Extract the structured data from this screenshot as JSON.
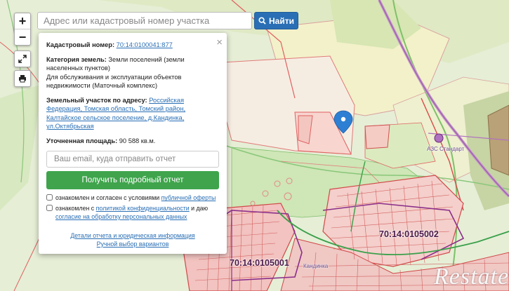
{
  "search": {
    "placeholder": "Адрес или кадастровый номер участка",
    "button_label": "Найти"
  },
  "map_controls": {
    "zoom_in": "+",
    "zoom_out": "−"
  },
  "popup": {
    "close": "×",
    "cadastral_label": "Кадастровый номер:",
    "cadastral_number": "70:14:0100041:877",
    "category_label": "Категория земель:",
    "category_value": "Земли поселений (земли населенных пунктов)",
    "usage": "Для обслуживания и эксплуатации объектов недвижимости (Маточный комплекс)",
    "address_label": "Земельный участок по адресу:",
    "address_value": "Российская Федерация, Томская область, Томский район, Калтайское сельское поселение, д.Кандинка, ул.Октябрьская",
    "area_label": "Уточненная площадь:",
    "area_value": "90 588 кв.м.",
    "email_placeholder": "Ваш email, куда отправить отчет",
    "submit_label": "Получить подробный отчет",
    "consent1_text": "ознакомлен и согласен с условиями",
    "consent1_link": "публичной оферты",
    "consent2_text": "ознакомлен с",
    "consent2_link": "политикой конфиденциальности",
    "consent2_and": "и даю",
    "consent2_link2": "согласие на обработку персональных данных",
    "details_link": "Детали отчета и юридическая информация",
    "manual_link": "Ручной выбор вариантов"
  },
  "map_labels": {
    "label_east": "70:14:0105002",
    "label_south": "70:14:0105001",
    "label_gas": "АЗС Стандарт",
    "label_small": "Кандинка"
  },
  "watermark": "Restate",
  "colors": {
    "accent_blue": "#2a6fb5",
    "green_button": "#3fa44c",
    "parcel_line": "#e06060",
    "map_pin": "#2d7fd3"
  }
}
